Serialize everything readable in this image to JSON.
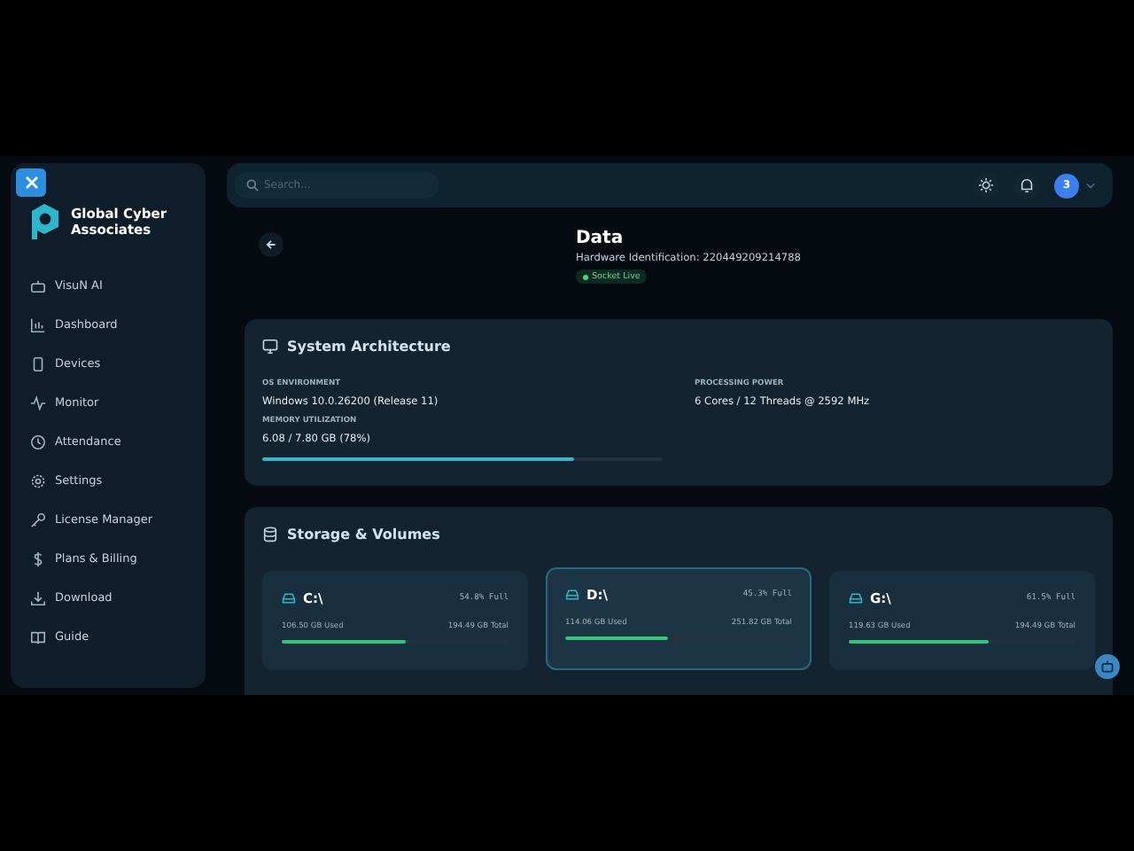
{
  "sidebar": {
    "brand": "Global Cyber Associates",
    "items": [
      {
        "label": "VisuN AI"
      },
      {
        "label": "Dashboard"
      },
      {
        "label": "Devices"
      },
      {
        "label": "Monitor"
      },
      {
        "label": "Attendance"
      },
      {
        "label": "Settings"
      },
      {
        "label": "License Manager"
      },
      {
        "label": "Plans & Billing"
      },
      {
        "label": "Download"
      },
      {
        "label": "Guide"
      }
    ]
  },
  "header": {
    "search": {
      "placeholder": "Search..."
    },
    "avatar": "3"
  },
  "page": {
    "title": "Data",
    "hardware": "Hardware Identification: 220449209214788",
    "status": "Socket Live"
  },
  "system": {
    "title": "System Architecture",
    "fields": [
      {
        "label": "OS ENVIRONMENT",
        "value": "Windows 10.0.26200 (Release 11)"
      },
      {
        "label": "PROCESSING POWER",
        "value": "6 Cores / 12 Threads @ 2592 MHz"
      }
    ],
    "memory": {
      "label": "MEMORY UTILIZATION",
      "value": "6.08 / 7.80 GB (78%)",
      "level": 0.78
    }
  },
  "storage": {
    "title": "Storage & Volumes",
    "drives": [
      {
        "name": "C:\\",
        "percent": "54.8% Full",
        "used": "106.50 GB Used",
        "total": "194.49 GB Total",
        "level": 0.548,
        "highlighted": false
      },
      {
        "name": "D:\\",
        "percent": "45.3% Full",
        "used": "114.06 GB Used",
        "total": "251.82 GB Total",
        "level": 0.453,
        "highlighted": true
      },
      {
        "name": "G:\\",
        "percent": "61.5% Full",
        "used": "119.63 GB Used",
        "total": "194.49 GB Total",
        "level": 0.615,
        "highlighted": false
      }
    ]
  }
}
